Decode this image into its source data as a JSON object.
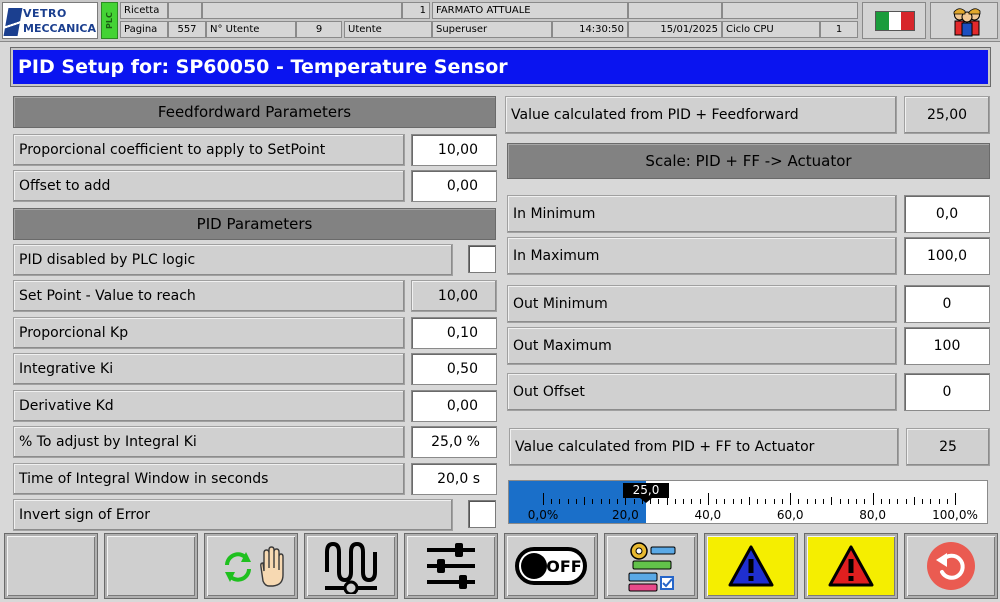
{
  "header": {
    "logo": {
      "line1": "VETRO",
      "line2": "MECCANICA"
    },
    "plc_badge": "PLC",
    "row1": {
      "ricetta_label": "Ricetta",
      "ricetta_code": "",
      "ricetta_name": "",
      "index_value": "1",
      "format_label": "FARMATO ATTUALE",
      "extra1": "",
      "extra2": ""
    },
    "row2": {
      "pagina_label": "Pagina",
      "pagina_value": "557",
      "utente_num_label": "N° Utente",
      "utente_num_value": "9",
      "utente_label": "Utente",
      "utente_value": "Superuser",
      "time": "14:30:50",
      "date": "15/01/2025",
      "ciclo_label": "Ciclo CPU",
      "ciclo_value": "1"
    },
    "flag_colors": [
      "#1a9c3b",
      "#ffffff",
      "#d7262b"
    ]
  },
  "title": "PID Setup for: SP60050 - Temperature Sensor",
  "feedforward": {
    "section_title": "Feedfordward Parameters",
    "rows": [
      {
        "label": "Proporcional coefficient to apply to SetPoint",
        "value": "10,00"
      },
      {
        "label": "Offset to add",
        "value": "0,00"
      }
    ]
  },
  "pid": {
    "section_title": "PID Parameters",
    "disabled_label": "PID disabled by PLC logic",
    "disabled_checked": false,
    "setpoint_label": "Set Point - Value to reach",
    "setpoint_value": "10,00",
    "rows": [
      {
        "label": "Proporcional Kp",
        "value": "0,10"
      },
      {
        "label": "Integrative Ki",
        "value": "0,50"
      },
      {
        "label": "Derivative Kd",
        "value": "0,00"
      },
      {
        "label": "% To adjust by Integral Ki",
        "value": "25,0 %"
      },
      {
        "label": "Time of  Integral Window in seconds",
        "value": "20,0 s"
      }
    ],
    "invert_label": "Invert sign of Error",
    "invert_checked": false
  },
  "right": {
    "calc_label": "Value calculated from PID + Feedforward",
    "calc_value": "25,00",
    "scale_title": "Scale: PID + FF -> Actuator",
    "scale_rows": [
      {
        "label": "In Minimum",
        "value": "0,0"
      },
      {
        "label": "In Maximum",
        "value": "100,0"
      },
      {
        "label": "Out Minimum",
        "value": "0"
      },
      {
        "label": "Out Maximum",
        "value": "100"
      },
      {
        "label": "Out Offset",
        "value": "0"
      }
    ],
    "actuator_label": "Value calculated from PID + FF to Actuator",
    "actuator_value": "25"
  },
  "gauge": {
    "min": 0,
    "max": 100,
    "value": 25,
    "value_label": "25,0",
    "tick_labels": [
      "0,0%",
      "20,0",
      "40,0",
      "60,0",
      "80,0",
      "100,0%"
    ],
    "fill_color": "#1a6fc9"
  },
  "toolbar": {
    "buttons": [
      {
        "name": "toolbar-empty-1",
        "icon": ""
      },
      {
        "name": "toolbar-empty-2",
        "icon": ""
      },
      {
        "name": "auto-manual-button",
        "icon": "refresh-hand-icon"
      },
      {
        "name": "trend-button",
        "icon": "signal-wave-icon"
      },
      {
        "name": "settings-sliders-button",
        "icon": "sliders-icon"
      },
      {
        "name": "off-button",
        "icon": "off-toggle-icon",
        "text": "OFF"
      },
      {
        "name": "config-button",
        "icon": "gear-list-icon"
      },
      {
        "name": "warnings-button",
        "icon": "blue-warning-icon"
      },
      {
        "name": "alarms-button",
        "icon": "red-warning-icon"
      },
      {
        "name": "back-button",
        "icon": "back-arrow-icon"
      }
    ]
  }
}
